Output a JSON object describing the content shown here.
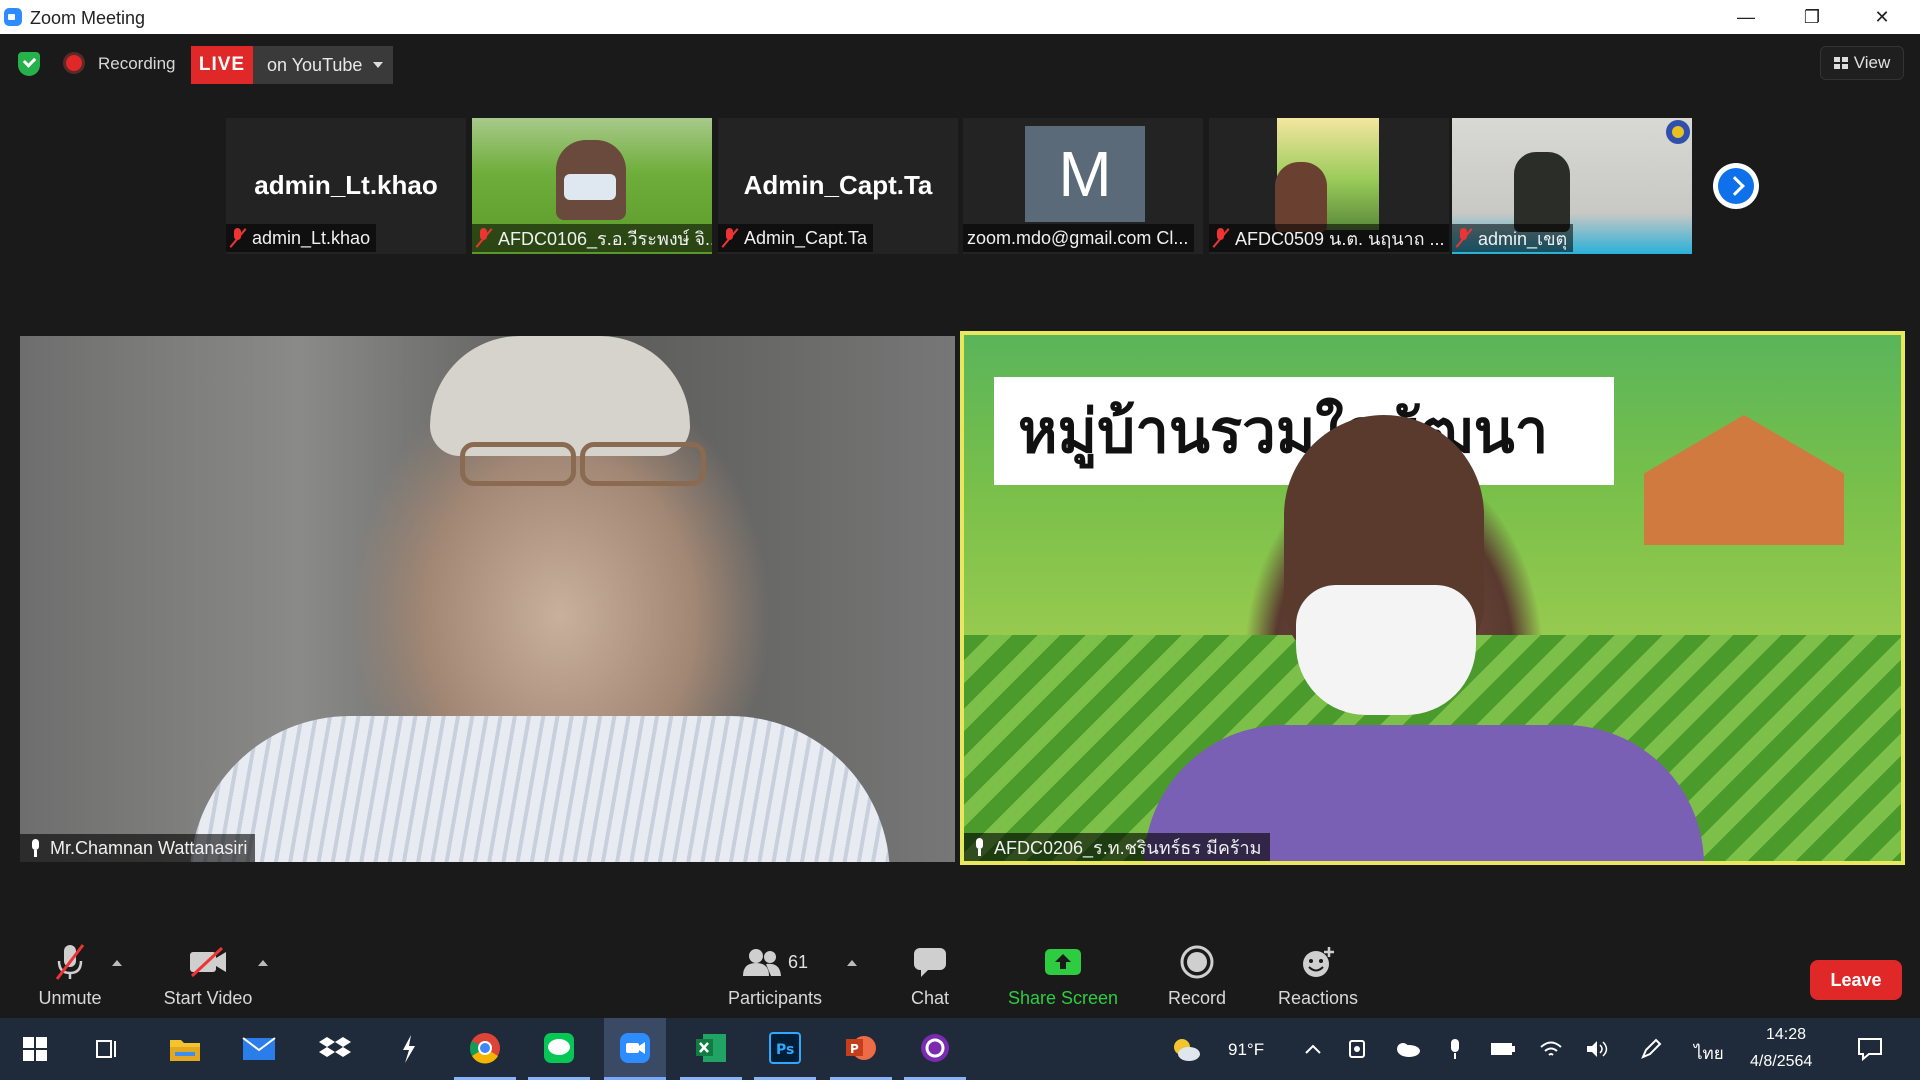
{
  "window": {
    "title": "Zoom Meeting"
  },
  "topbar": {
    "recording_label": "Recording",
    "live_label": "LIVE",
    "stream_target": "on YouTube",
    "view_label": "View"
  },
  "thumbnails": [
    {
      "display_name": "admin_Lt.khao",
      "label": "admin_Lt.khao",
      "muted": true
    },
    {
      "display_name": "",
      "label": "AFDC0106_ร.อ.วีระพงษ์ จิ...",
      "muted": true
    },
    {
      "display_name": "Admin_Capt.Ta",
      "label": "Admin_Capt.Ta",
      "muted": true
    },
    {
      "display_name": "M",
      "label": "zoom.mdo@gmail.com Cl...",
      "muted": false
    },
    {
      "display_name": "",
      "label": "AFDC0509 น.ต. นฤนาถ ...",
      "muted": true
    },
    {
      "display_name": "",
      "label": "admin_เขตุ",
      "muted": true
    }
  ],
  "main_videos": {
    "left_label": "Mr.Chamnan Wattanasiri",
    "right_label": "AFDC0206_ร.ท.ชรินทร์ธร มีคร้าม",
    "right_banner": "หมู่บ้านรวมใจพัฒนา"
  },
  "controls": {
    "unmute": "Unmute",
    "start_video": "Start Video",
    "participants": "Participants",
    "participants_count": "61",
    "chat": "Chat",
    "share_screen": "Share Screen",
    "record": "Record",
    "reactions": "Reactions",
    "leave": "Leave"
  },
  "taskbar": {
    "weather": "91°F",
    "language": "ไทย",
    "time": "14:28",
    "date": "4/8/2564"
  },
  "colors": {
    "live_red": "#e02828",
    "share_green": "#2ecc40",
    "active_speaker_border": "#e8e85c",
    "zoom_blue": "#0e71eb"
  }
}
